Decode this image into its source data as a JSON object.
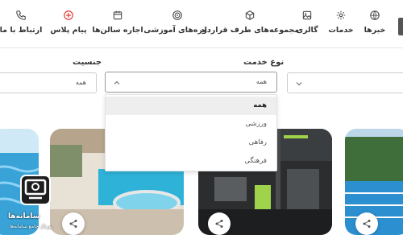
{
  "nav": {
    "items": [
      {
        "label": "ارتباط با ما",
        "icon": "phone-icon"
      },
      {
        "label": "پیام پلاس",
        "icon": "plus-circle-icon"
      },
      {
        "label": "اجاره سالن‌ها",
        "icon": "calendar-icon"
      },
      {
        "label": "دوره‌های آموزشی",
        "icon": "target-icon"
      },
      {
        "label": "مجموعه‌های طرف قرارداد",
        "icon": "cube-icon"
      },
      {
        "label": "گالری",
        "icon": "image-icon"
      },
      {
        "label": "خدمات",
        "icon": "gear-icon"
      },
      {
        "label": "خبرها",
        "icon": "globe-icon"
      }
    ],
    "accent": "#e53935"
  },
  "filters": {
    "gender_label": "جنسیت",
    "service_label": "نوع خدمت",
    "gender_value": "همه",
    "service_value": "همه"
  },
  "dropdown": {
    "options": [
      "همه",
      "ورزشی",
      "رفاهی",
      "فرهنگی"
    ],
    "selected": "همه"
  },
  "watermark": {
    "title": "سامانه‌ها",
    "subtitle": "پورتال جامع سامانه‌ها"
  }
}
